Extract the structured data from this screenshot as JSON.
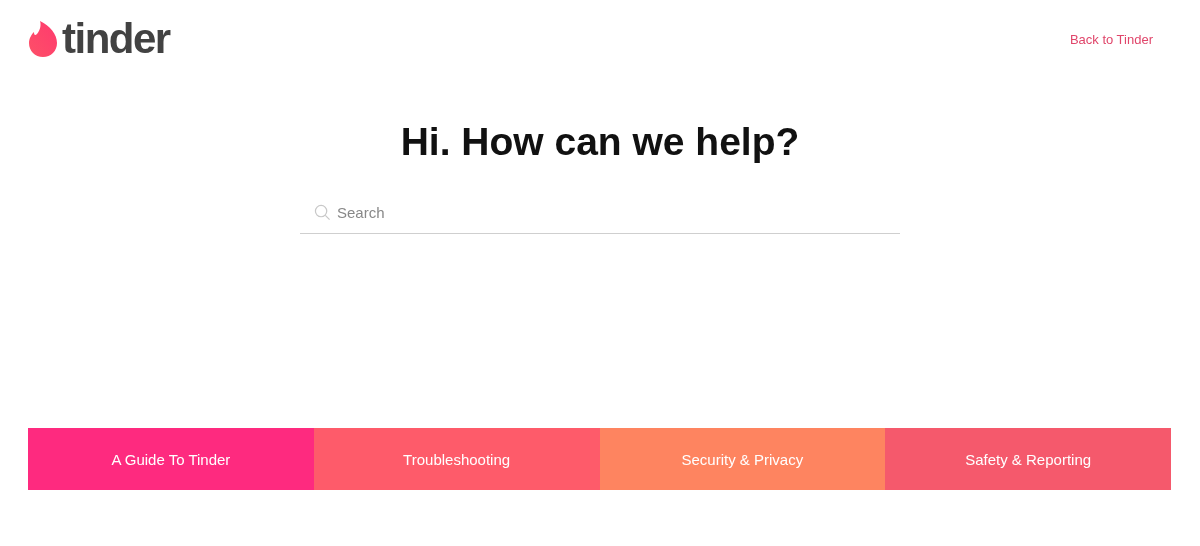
{
  "header": {
    "logo": "tinder",
    "back_link": "Back to Tinder"
  },
  "hero": {
    "title": "Hi. How can we help?"
  },
  "search": {
    "placeholder": "Search"
  },
  "categories": [
    {
      "label": "A Guide To Tinder",
      "color": "#fe2a7f"
    },
    {
      "label": "Troubleshooting",
      "color": "#fe5b6a"
    },
    {
      "label": "Security & Privacy",
      "color": "#fe8460"
    },
    {
      "label": "Safety & Reporting",
      "color": "#f5596c"
    }
  ]
}
